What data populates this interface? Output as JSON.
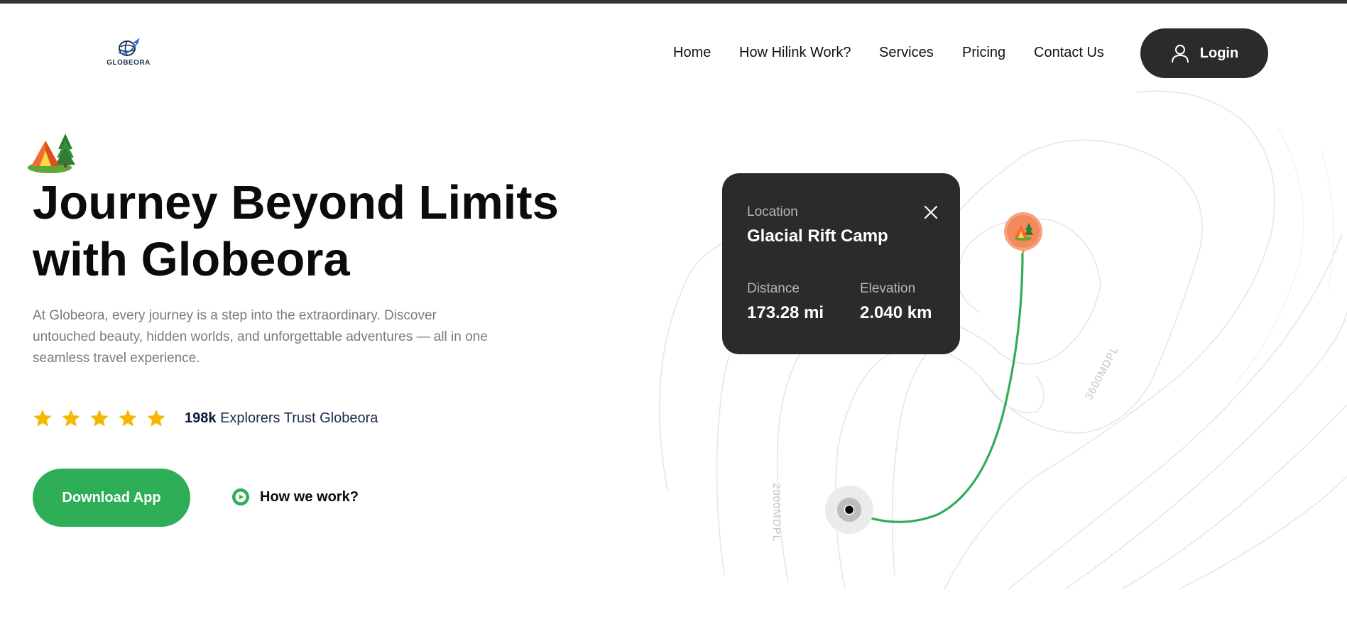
{
  "brand": {
    "name": "GLOBEORA",
    "logo_icon": "globe-plane-icon"
  },
  "nav": {
    "items": [
      {
        "label": "Home"
      },
      {
        "label": "How Hilink Work?"
      },
      {
        "label": "Services"
      },
      {
        "label": "Pricing"
      },
      {
        "label": "Contact Us"
      }
    ],
    "login_label": "Login",
    "login_icon": "user-icon"
  },
  "hero": {
    "badge_icon": "camping-tent-icon",
    "title_line1": "Journey Beyond Limits",
    "title_line2": "with Globeora",
    "description": "At Globeora, every journey is a step into the extraordinary. Discover untouched beauty, hidden worlds, and unforgettable adventures — all in one seamless travel experience.",
    "rating": {
      "stars": 5,
      "count": "198k",
      "text": "Explorers Trust Globeora"
    },
    "download_label": "Download App",
    "how_label": "How we work?"
  },
  "map": {
    "contour_labels": [
      "2000MDPL",
      "3600MDPL"
    ],
    "card": {
      "location_label": "Location",
      "location_value": "Glacial Rift Camp",
      "distance_label": "Distance",
      "distance_value": "173.28 mi",
      "elevation_label": "Elevation",
      "elevation_value": "2.040 km"
    }
  },
  "colors": {
    "accent_green": "#2fae58",
    "dark": "#2b2c29",
    "star": "#f5b800",
    "pin": "#f28a5e"
  }
}
